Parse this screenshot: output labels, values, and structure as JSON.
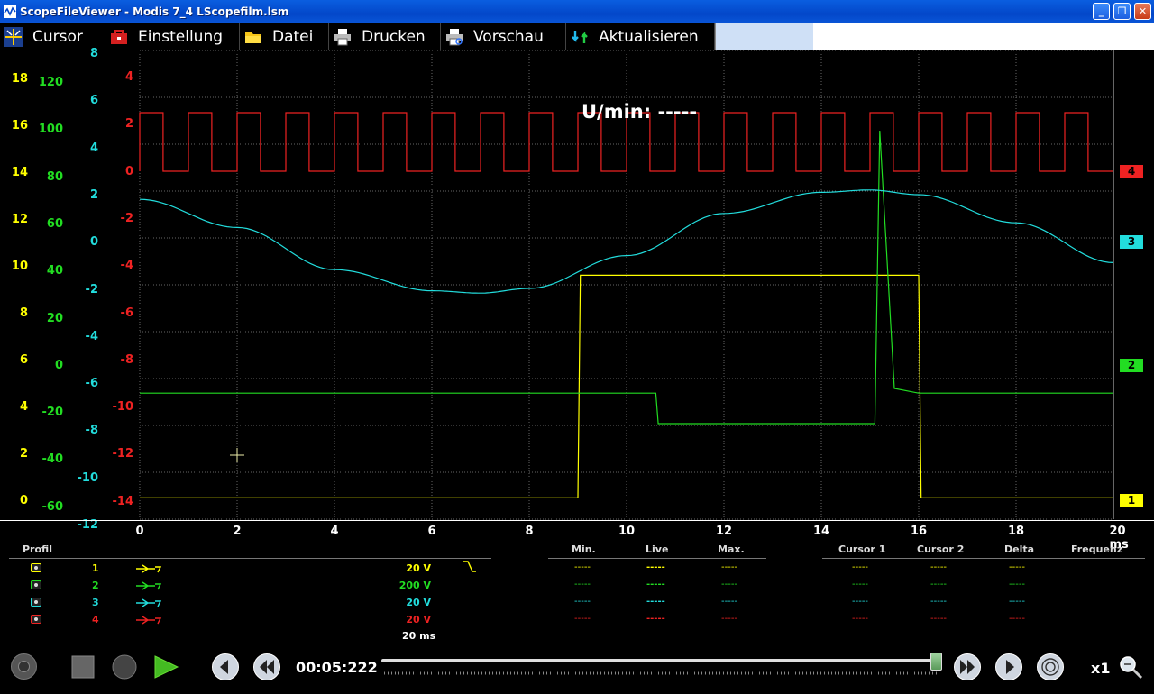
{
  "window": {
    "title": "ScopeFileViewer - Modis 7_4 LScopefilm.lsm"
  },
  "toolbar": {
    "cursor": "Cursor",
    "settings": "Einstellung",
    "file": "Datei",
    "print": "Drucken",
    "preview": "Vorschau",
    "refresh": "Aktualisieren"
  },
  "scope": {
    "rpm_label": "U/min: -----",
    "channel_tags": [
      "4",
      "3",
      "2",
      "1"
    ],
    "axes": {
      "ch1": [
        "18",
        "16",
        "14",
        "12",
        "10",
        "8",
        "6",
        "4",
        "2",
        "0"
      ],
      "ch2": [
        "120",
        "100",
        "80",
        "60",
        "40",
        "20",
        "0",
        "-20",
        "-40",
        "-60"
      ],
      "ch3": [
        "8",
        "6",
        "4",
        "2",
        "0",
        "-2",
        "-4",
        "-6",
        "-8",
        "-10",
        "-12"
      ],
      "ch4": [
        "4",
        "2",
        "0",
        "-2",
        "-4",
        "-6",
        "-8",
        "-10",
        "-12",
        "-14"
      ]
    },
    "x_ticks": [
      "0",
      "2",
      "4",
      "6",
      "8",
      "10",
      "12",
      "14",
      "16",
      "18",
      "20 ms"
    ],
    "colors": {
      "ch1": "#ffff00",
      "ch2": "#22dd22",
      "ch3": "#22dddd",
      "ch4": "#ee2222",
      "grid": "#666666"
    }
  },
  "chart_data": {
    "type": "line",
    "x_unit": "ms",
    "xlim": [
      0,
      20
    ],
    "series": [
      {
        "name": "1",
        "unit": "V",
        "scale": "20 V",
        "x": [
          0,
          9.0,
          9.05,
          16.0,
          16.05,
          20
        ],
        "values": [
          0.1,
          0.1,
          9.6,
          9.6,
          0.1,
          0.1
        ]
      },
      {
        "name": "2",
        "unit": "V",
        "scale": "200 V",
        "x": [
          0,
          10.6,
          10.65,
          15.1,
          15.2,
          15.5,
          16,
          20
        ],
        "values": [
          -12,
          -12,
          -25,
          -25,
          100,
          -10,
          -12,
          -12
        ]
      },
      {
        "name": "3",
        "unit": "V",
        "scale": "20 V",
        "x": [
          0,
          2,
          4,
          6,
          7,
          8,
          10,
          12,
          14,
          15,
          16,
          18,
          20
        ],
        "values": [
          1.8,
          0.6,
          -1.2,
          -2.1,
          -2.2,
          -2.0,
          -0.6,
          1.2,
          2.1,
          2.2,
          2.0,
          0.8,
          -0.9
        ]
      },
      {
        "name": "4",
        "unit": "V",
        "scale": "20 V",
        "square_wave": {
          "period_ms": 1.0,
          "first_rise_ms": 0.0,
          "duty": 0.48,
          "low": 0,
          "high": 5
        }
      }
    ]
  },
  "table": {
    "profile_label": "Profil",
    "headers": {
      "min": "Min.",
      "live": "Live",
      "max": "Max.",
      "c1": "Cursor 1",
      "c2": "Cursor 2",
      "delta": "Delta",
      "freq": "Frequenz"
    },
    "rows": [
      {
        "num": "1",
        "scale": "20 V",
        "min": "-----",
        "live": "-----",
        "max": "-----",
        "c1": "-----",
        "c2": "-----",
        "delta": "-----",
        "color": "#ffff00"
      },
      {
        "num": "2",
        "scale": "200 V",
        "min": "-----",
        "live": "-----",
        "max": "-----",
        "c1": "-----",
        "c2": "-----",
        "delta": "-----",
        "color": "#22dd22"
      },
      {
        "num": "3",
        "scale": "20 V",
        "min": "-----",
        "live": "-----",
        "max": "-----",
        "c1": "-----",
        "c2": "-----",
        "delta": "-----",
        "color": "#22dddd"
      },
      {
        "num": "4",
        "scale": "20 V",
        "min": "-----",
        "live": "-----",
        "max": "-----",
        "c1": "-----",
        "c2": "-----",
        "delta": "-----",
        "color": "#ee2222"
      }
    ],
    "timebase": "20 ms"
  },
  "player": {
    "time": "00:05:222",
    "speed": "x1",
    "progress": 0.99
  }
}
